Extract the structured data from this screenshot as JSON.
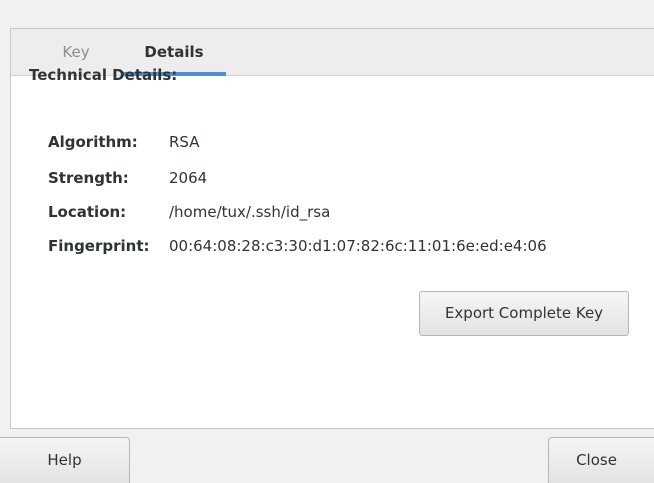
{
  "tabs": [
    {
      "label": "Key",
      "active": false
    },
    {
      "label": "Details",
      "active": true
    }
  ],
  "details": {
    "section_title": "Technical Details:",
    "rows": [
      {
        "label": "Algorithm:",
        "value": "RSA"
      },
      {
        "label": "Strength:",
        "value": "2064"
      },
      {
        "label": "Location:",
        "value": "/home/tux/.ssh/id_rsa"
      },
      {
        "label": "Fingerprint:",
        "value": "00:64:08:28:c3:30:d1:07:82:6c:11:01:6e:ed:e4:06"
      }
    ],
    "export_label": "Export Complete Key"
  },
  "footer": {
    "help_label": "Help",
    "close_label": "Close"
  },
  "colors": {
    "accent": "#4a90d9",
    "background": "#f1f1f1",
    "panel": "#ffffff"
  }
}
